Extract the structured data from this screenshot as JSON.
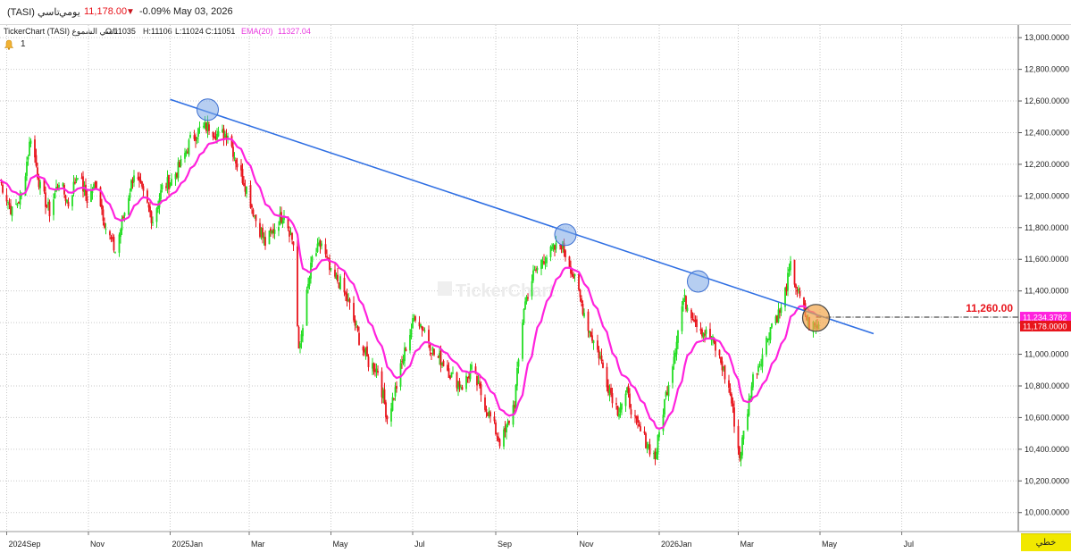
{
  "header": {
    "symbol": "(TASI) تاسي",
    "period": "يومي",
    "price": "11,178.00",
    "change_pct": "-0.09%",
    "date": "May 03, 2026",
    "down_arrow": "▼"
  },
  "info": {
    "name": "TickerChart (TASI) تاسي الشموع",
    "open": "O:11035",
    "high": "H:11106",
    "low": "L:11024",
    "close": "C:11051",
    "ema_label": "EMA(20)",
    "ema_value": "11327.04"
  },
  "alerts": {
    "count": "1"
  },
  "toolbar": {
    "draw_label": "خطي"
  },
  "watermark": "TickerChart",
  "colors": {
    "up": "#22dd22",
    "down": "#e8141c",
    "ema": "#ff22dd",
    "trendline": "#2f6fe3",
    "marker": "#7aa6e6",
    "marker_current": "#f2a54a",
    "price_tag": "#e8141c",
    "ema_tag": "#ff22dd"
  },
  "chart_data": {
    "type": "candlestick",
    "y_ticks": [
      "10,000.0000",
      "10,200.0000",
      "10,400.0000",
      "10,600.0000",
      "10,800.0000",
      "11,000.0000",
      "11,200.0000",
      "11,400.0000",
      "11,600.0000",
      "11,800.0000",
      "12,000.0000",
      "12,200.0000",
      "12,400.0000",
      "12,600.0000",
      "12,800.0000",
      "13,000.0000"
    ],
    "ylim": [
      9880,
      13080
    ],
    "x_labels": [
      {
        "label": "2024Sep",
        "date": "2024-09-01"
      },
      {
        "label": "Nov",
        "date": "2024-11-01"
      },
      {
        "label": "2025Jan",
        "date": "2025-01-01"
      },
      {
        "label": "Mar",
        "date": "2025-03-01"
      },
      {
        "label": "May",
        "date": "2025-05-01"
      },
      {
        "label": "Jul",
        "date": "2025-07-01"
      },
      {
        "label": "Sep",
        "date": "2025-09-01"
      },
      {
        "label": "Nov",
        "date": "2025-11-01"
      },
      {
        "label": "2026Jan",
        "date": "2026-01-01"
      },
      {
        "label": "Mar",
        "date": "2026-03-01"
      },
      {
        "label": "May",
        "date": "2026-05-01"
      },
      {
        "label": "Jul",
        "date": "2026-07-01"
      }
    ],
    "xlim": [
      "2024-08-27",
      "2026-09-26"
    ],
    "path": [
      [
        "2024-08-27",
        12100
      ],
      [
        "2024-09-05",
        11900
      ],
      [
        "2024-09-12",
        12000
      ],
      [
        "2024-09-19",
        12380
      ],
      [
        "2024-09-26",
        12050
      ],
      [
        "2024-10-03",
        11900
      ],
      [
        "2024-10-10",
        12100
      ],
      [
        "2024-10-17",
        11950
      ],
      [
        "2024-10-24",
        12150
      ],
      [
        "2024-10-31",
        11980
      ],
      [
        "2024-11-07",
        12080
      ],
      [
        "2024-11-14",
        11800
      ],
      [
        "2024-11-21",
        11650
      ],
      [
        "2024-11-28",
        11900
      ],
      [
        "2024-12-05",
        12150
      ],
      [
        "2024-12-12",
        12000
      ],
      [
        "2024-12-19",
        11850
      ],
      [
        "2024-12-26",
        12050
      ],
      [
        "2025-01-02",
        12100
      ],
      [
        "2025-01-09",
        12200
      ],
      [
        "2025-01-16",
        12350
      ],
      [
        "2025-01-23",
        12420
      ],
      [
        "2025-01-30",
        12440
      ],
      [
        "2025-02-06",
        12380
      ],
      [
        "2025-02-13",
        12400
      ],
      [
        "2025-02-20",
        12200
      ],
      [
        "2025-02-27",
        12050
      ],
      [
        "2025-03-06",
        11850
      ],
      [
        "2025-03-13",
        11700
      ],
      [
        "2025-03-20",
        11800
      ],
      [
        "2025-03-27",
        11900
      ],
      [
        "2025-04-03",
        11700
      ],
      [
        "2025-04-07",
        11000
      ],
      [
        "2025-04-10",
        11200
      ],
      [
        "2025-04-17",
        11600
      ],
      [
        "2025-04-24",
        11700
      ],
      [
        "2025-05-01",
        11500
      ],
      [
        "2025-05-08",
        11450
      ],
      [
        "2025-05-15",
        11300
      ],
      [
        "2025-05-22",
        11100
      ],
      [
        "2025-05-29",
        10950
      ],
      [
        "2025-06-05",
        10900
      ],
      [
        "2025-06-12",
        10600
      ],
      [
        "2025-06-19",
        10800
      ],
      [
        "2025-06-26",
        11050
      ],
      [
        "2025-07-03",
        11250
      ],
      [
        "2025-07-10",
        11150
      ],
      [
        "2025-07-17",
        11000
      ],
      [
        "2025-07-24",
        10950
      ],
      [
        "2025-07-31",
        10850
      ],
      [
        "2025-08-07",
        10800
      ],
      [
        "2025-08-14",
        10900
      ],
      [
        "2025-08-21",
        10750
      ],
      [
        "2025-08-28",
        10600
      ],
      [
        "2025-09-04",
        10450
      ],
      [
        "2025-09-08",
        10500
      ],
      [
        "2025-09-15",
        10700
      ],
      [
        "2025-09-22",
        11300
      ],
      [
        "2025-09-29",
        11500
      ],
      [
        "2025-10-06",
        11600
      ],
      [
        "2025-10-13",
        11650
      ],
      [
        "2025-10-20",
        11700
      ],
      [
        "2025-10-27",
        11550
      ],
      [
        "2025-11-03",
        11350
      ],
      [
        "2025-11-10",
        11150
      ],
      [
        "2025-11-17",
        11000
      ],
      [
        "2025-11-24",
        10800
      ],
      [
        "2025-12-01",
        10650
      ],
      [
        "2025-12-08",
        10750
      ],
      [
        "2025-12-15",
        10550
      ],
      [
        "2025-12-22",
        10450
      ],
      [
        "2025-12-29",
        10350
      ],
      [
        "2026-01-05",
        10700
      ],
      [
        "2026-01-12",
        11000
      ],
      [
        "2026-01-19",
        11350
      ],
      [
        "2026-01-26",
        11250
      ],
      [
        "2026-02-02",
        11150
      ],
      [
        "2026-02-09",
        11100
      ],
      [
        "2026-02-16",
        10950
      ],
      [
        "2026-02-23",
        10750
      ],
      [
        "2026-03-02",
        10350
      ],
      [
        "2026-03-05",
        10500
      ],
      [
        "2026-03-12",
        10850
      ],
      [
        "2026-03-19",
        11000
      ],
      [
        "2026-03-26",
        11200
      ],
      [
        "2026-04-02",
        11280
      ],
      [
        "2026-04-09",
        11550
      ],
      [
        "2026-04-16",
        11350
      ],
      [
        "2026-04-23",
        11180
      ],
      [
        "2026-04-30",
        11178
      ]
    ],
    "ema_label": "EMA(20)",
    "trendline": {
      "from": [
        "2025-01-01",
        12610
      ],
      "to": [
        "2026-06-10",
        11130
      ]
    },
    "touch_markers": [
      {
        "date": "2025-01-29",
        "value": 12545
      },
      {
        "date": "2025-10-23",
        "value": 11755
      },
      {
        "date": "2026-01-30",
        "value": 11460
      }
    ],
    "current_marker": {
      "date": "2026-04-28",
      "value": 11230
    },
    "level_line": {
      "value": 11234.3782,
      "label": "11,260.00"
    },
    "last_price": {
      "value": 11178,
      "label": "11,178.0000"
    },
    "ema_last": {
      "value": 11234.3782,
      "label": "11,234.3782"
    }
  }
}
